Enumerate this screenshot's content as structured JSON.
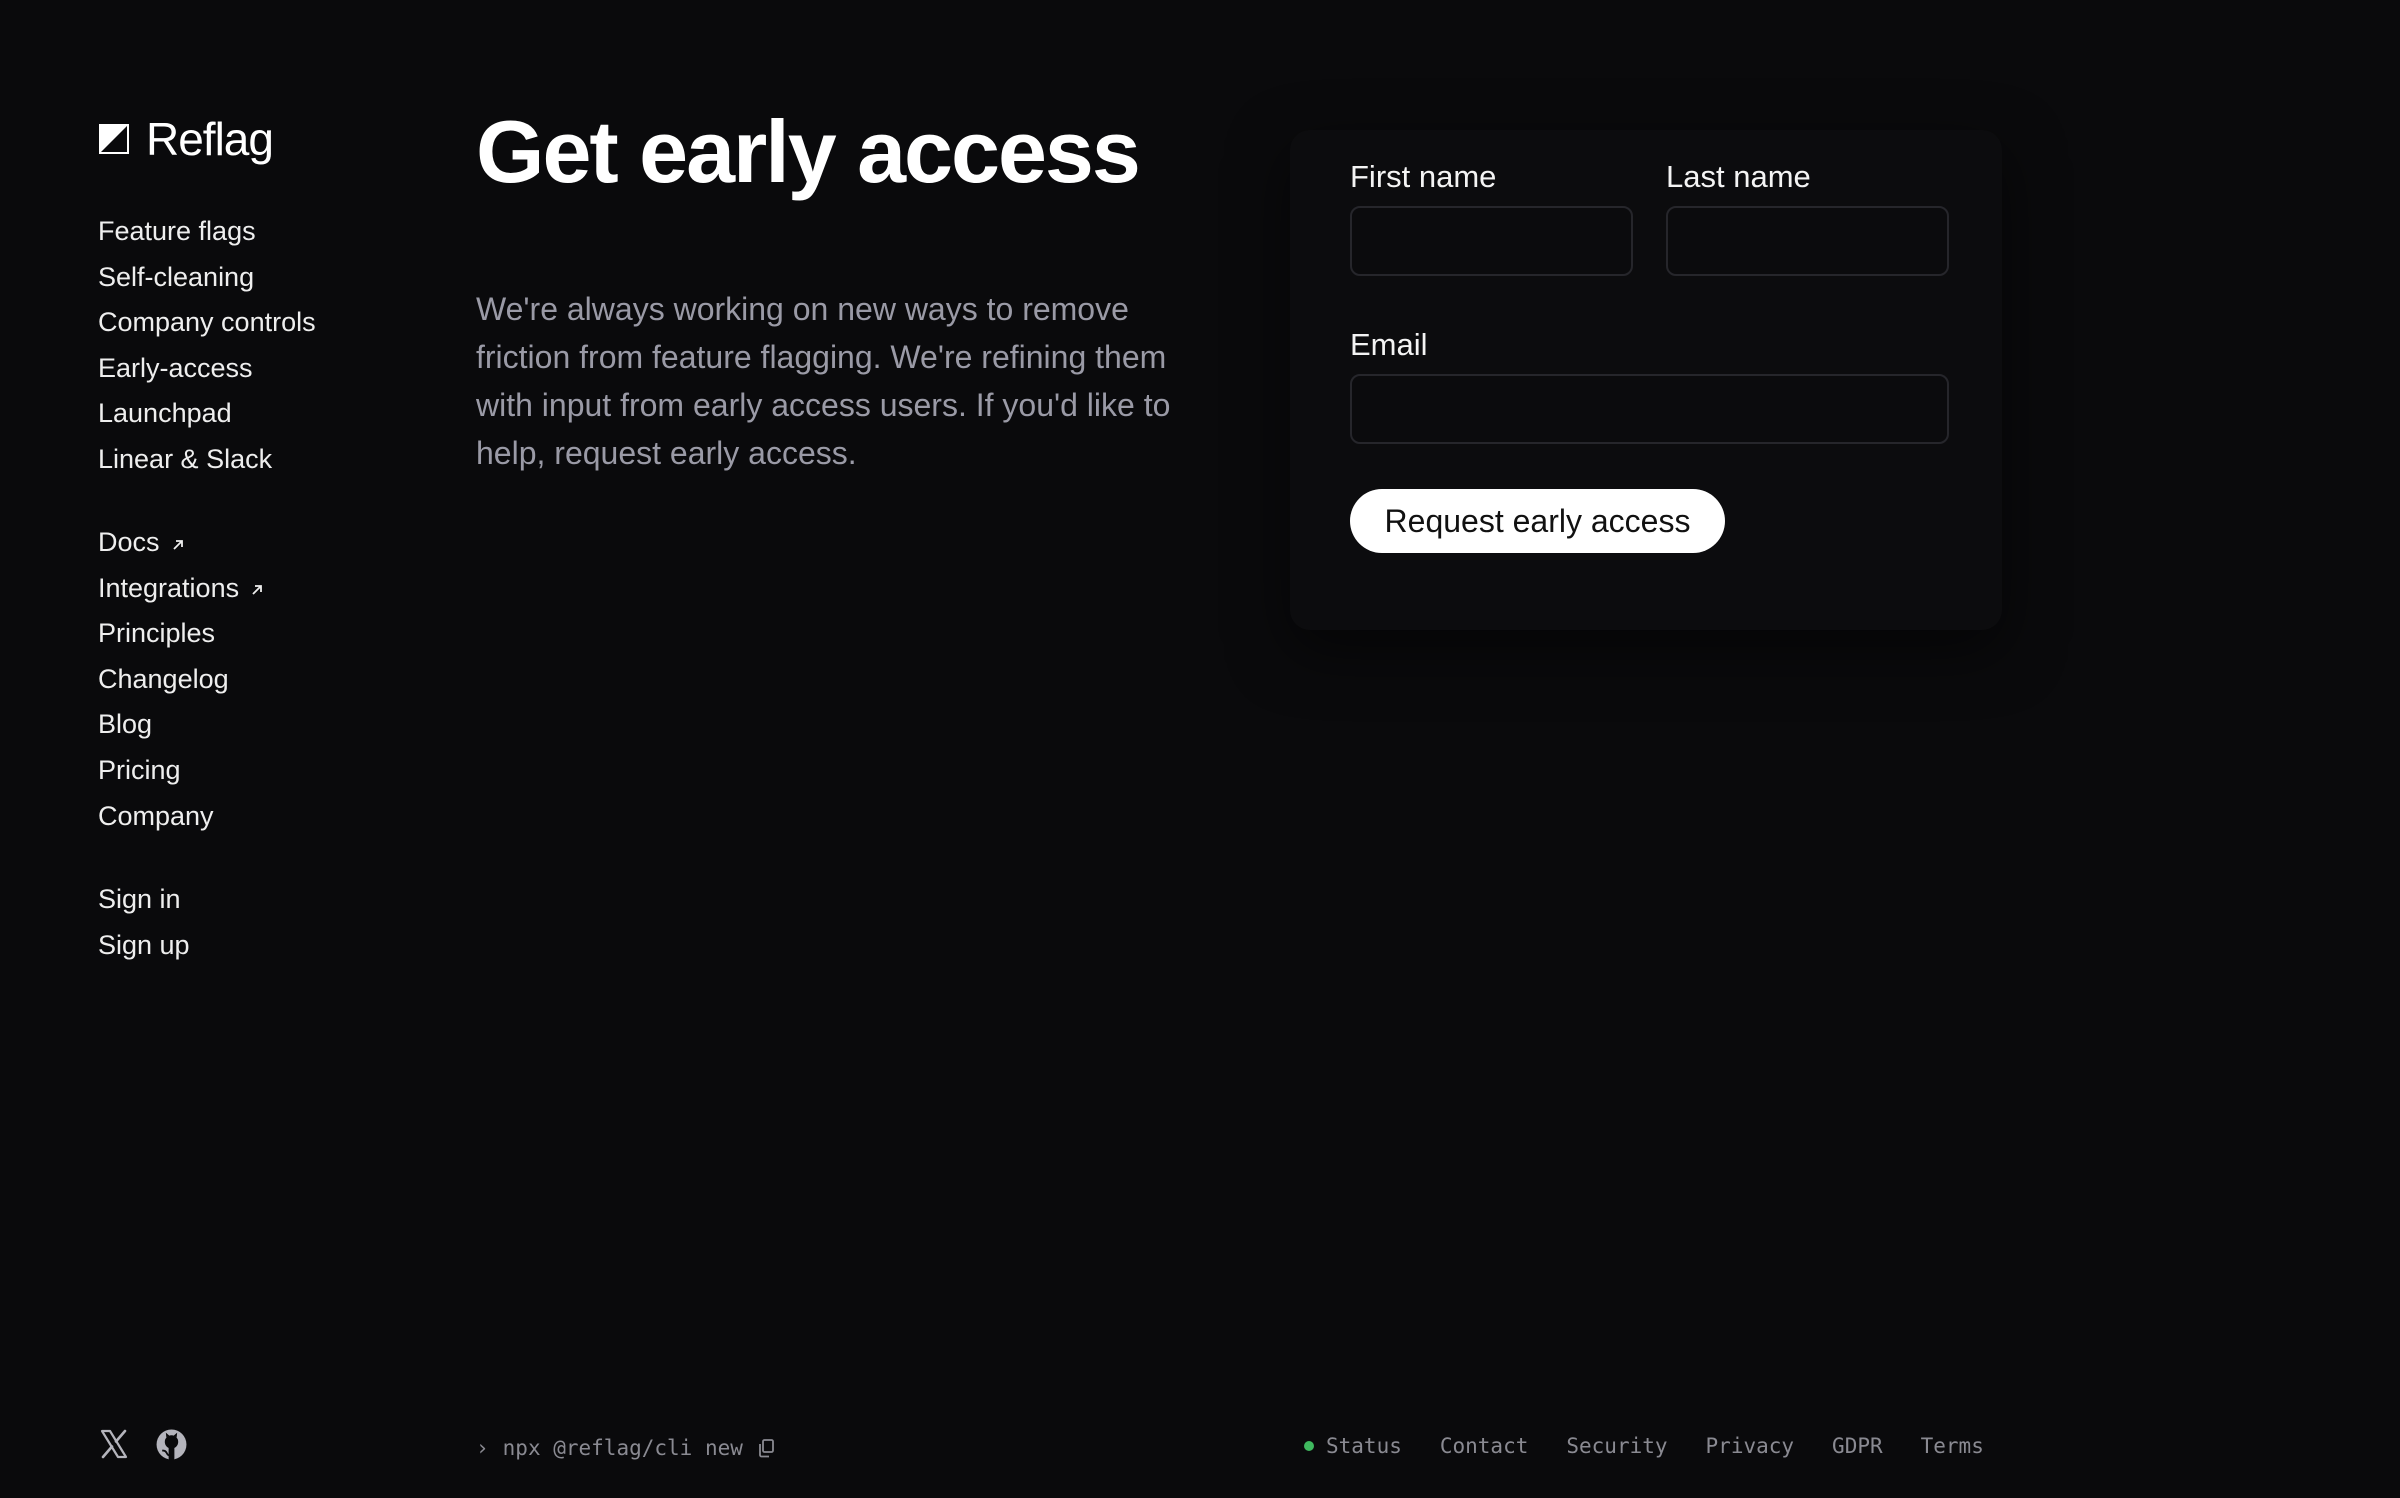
{
  "brand": {
    "name": "Reflag"
  },
  "nav": {
    "product": [
      {
        "label": "Feature flags"
      },
      {
        "label": "Self-cleaning"
      },
      {
        "label": "Company controls"
      },
      {
        "label": "Early-access"
      },
      {
        "label": "Launchpad"
      },
      {
        "label": "Linear & Slack"
      }
    ],
    "resources": [
      {
        "label": "Docs",
        "icon": "external-link-icon"
      },
      {
        "label": "Integrations",
        "icon": "external-link-icon"
      },
      {
        "label": "Principles"
      },
      {
        "label": "Changelog"
      },
      {
        "label": "Blog"
      },
      {
        "label": "Pricing"
      },
      {
        "label": "Company"
      }
    ],
    "account": [
      {
        "label": "Sign in"
      },
      {
        "label": "Sign up"
      }
    ]
  },
  "main": {
    "title": "Get early access",
    "intro": "We're always working on new ways to remove friction from feature flagging. We're refining them with input from early access users. If you'd like to help, request early access."
  },
  "form": {
    "first_name_label": "First name",
    "first_name_value": "",
    "last_name_label": "Last name",
    "last_name_value": "",
    "email_label": "Email",
    "email_value": "",
    "submit_label": "Request early access"
  },
  "footer": {
    "social": [
      {
        "icon": "x-icon"
      },
      {
        "icon": "github-icon"
      }
    ],
    "cli_prompt": "›",
    "cli_command": "npx @reflag/cli new",
    "links": {
      "status": "Status",
      "contact": "Contact",
      "security": "Security",
      "privacy": "Privacy",
      "gdpr": "GDPR",
      "terms": "Terms"
    },
    "status_color": "#3fb95f"
  },
  "colors": {
    "background": "#0a0a0c",
    "muted_text": "#9a9aa6",
    "button_bg": "#ffffff"
  }
}
